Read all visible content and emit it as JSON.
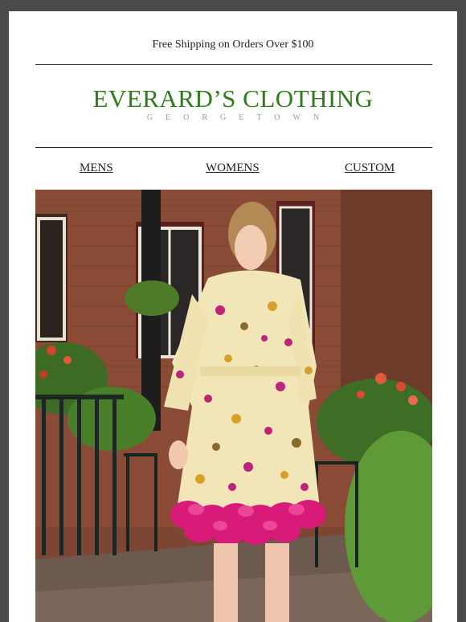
{
  "header": {
    "shipping_notice": "Free Shipping on Orders Over $100",
    "brand_name": "EVERARD’S CLOTHING",
    "brand_location": "GEORGETOWN"
  },
  "nav": {
    "items": [
      {
        "label": "MENS"
      },
      {
        "label": "WOMENS"
      },
      {
        "label": "CUSTOM"
      }
    ]
  },
  "hero": {
    "image": "hero-photo",
    "colors": {
      "brand_green": "#2e7d1a",
      "brick": "#8a4b36",
      "dress_cream": "#f2e6b8",
      "ruffle_pink": "#d81b79"
    }
  }
}
